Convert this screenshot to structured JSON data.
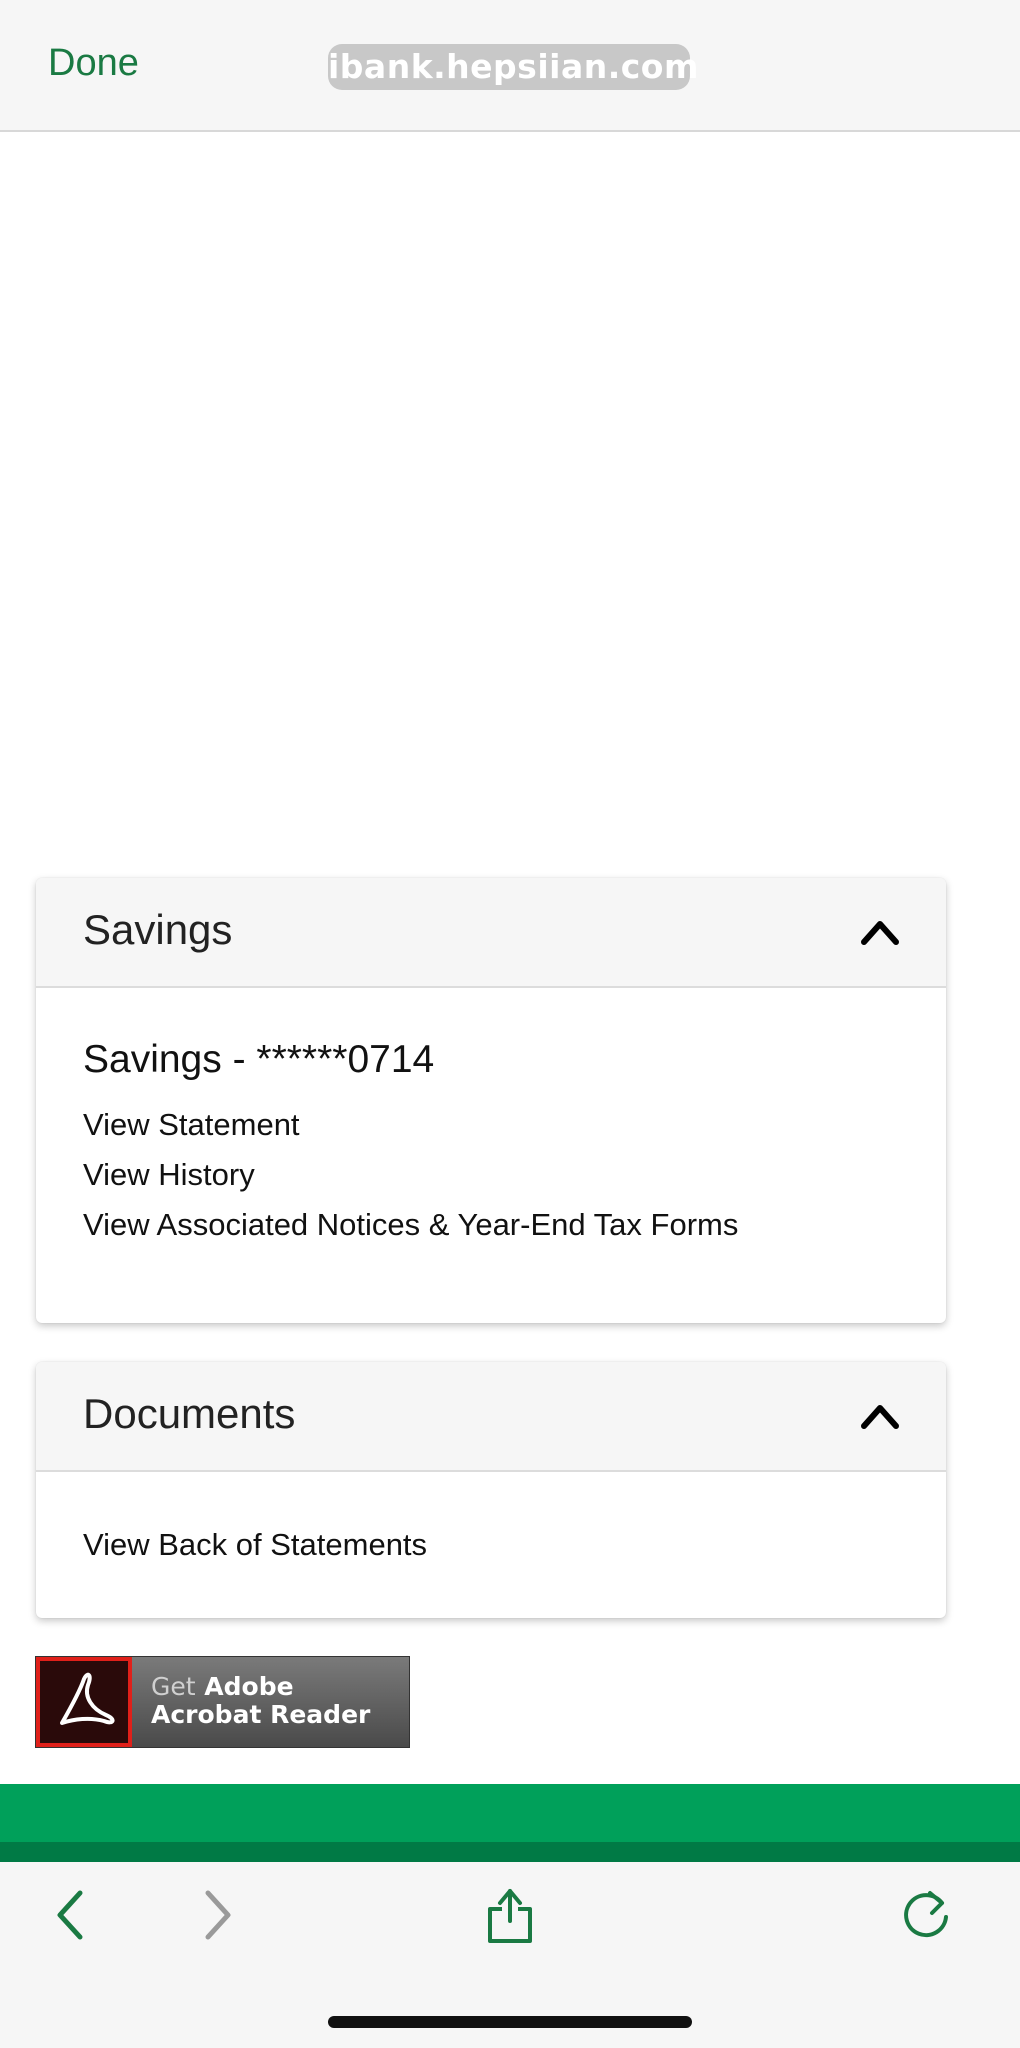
{
  "browser": {
    "done_label": "Done",
    "url": "ibank.hepsiian.com"
  },
  "savings_card": {
    "header": "Savings",
    "account_title": "Savings - ******0714",
    "links": [
      "View Statement",
      "View History",
      "View Associated Notices & Year-End Tax Forms"
    ]
  },
  "documents_card": {
    "header": "Documents",
    "links": [
      "View Back of Statements"
    ]
  },
  "adobe_badge": {
    "get": "Get",
    "line1": "Adobe",
    "line2": "Acrobat Reader"
  },
  "colors": {
    "accent_green": "#1a7a43",
    "band_green": "#00a05a",
    "band_green_dark": "#007a45"
  },
  "icons": {
    "toolbar": [
      "back-icon",
      "forward-icon",
      "share-icon",
      "reload-icon"
    ],
    "collapse": "chevron-up-icon"
  }
}
